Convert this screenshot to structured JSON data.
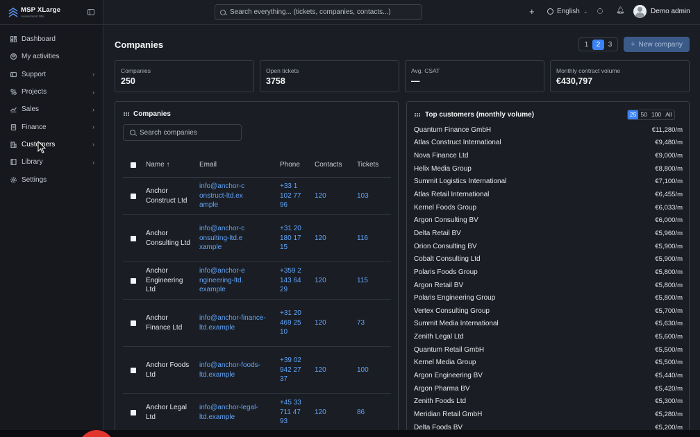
{
  "brand": {
    "name": "MSP XLarge",
    "subtitle": "Assessment Ntls"
  },
  "sidebar": {
    "items": [
      {
        "label": "Dashboard",
        "icon": "dashboard-icon",
        "chevron": false
      },
      {
        "label": "My activities",
        "icon": "user-circle-icon",
        "chevron": false
      },
      {
        "label": "Support",
        "icon": "ticket-icon",
        "chevron": true
      },
      {
        "label": "Projects",
        "icon": "projects-icon",
        "chevron": true
      },
      {
        "label": "Sales",
        "icon": "trend-icon",
        "chevron": true
      },
      {
        "label": "Finance",
        "icon": "document-icon",
        "chevron": true
      },
      {
        "label": "Customers",
        "icon": "building-icon",
        "chevron": true
      },
      {
        "label": "Library",
        "icon": "book-icon",
        "chevron": true
      },
      {
        "label": "Settings",
        "icon": "gear-icon",
        "chevron": false
      }
    ]
  },
  "topbar": {
    "search_placeholder": "Search everything... (tickets, companies, contacts...)",
    "language": "English",
    "user_name": "Demo admin"
  },
  "page": {
    "title": "Companies",
    "pages": [
      "1",
      "2",
      "3"
    ],
    "active_page": "2",
    "new_button": "New company"
  },
  "stats": [
    {
      "label": "Companies",
      "value": "250"
    },
    {
      "label": "Open tickets",
      "value": "3758"
    },
    {
      "label": "Avg. CSAT",
      "value": "—"
    },
    {
      "label": "Monthly contract volume",
      "value": "€430,797"
    }
  ],
  "companies_panel": {
    "title": "Companies",
    "search_placeholder": "Search companies",
    "columns": {
      "name": "Name ↑",
      "email": "Email",
      "phone": "Phone",
      "contacts": "Contacts",
      "tickets": "Tickets"
    },
    "rows": [
      {
        "name": "Anchor Construct Ltd",
        "email": "info@anchor-construct-ltd.example",
        "phone": "+33 1 102 77 96",
        "contacts": "120",
        "tickets": "103"
      },
      {
        "name": "Anchor Consulting Ltd",
        "email": "info@anchor-consulting-ltd.example",
        "phone": "+31 20 180 17 15",
        "contacts": "120",
        "tickets": "116"
      },
      {
        "name": "Anchor Engineering Ltd",
        "email": "info@anchor-engineering-ltd.example",
        "phone": "+359 2 143 64 29",
        "contacts": "120",
        "tickets": "115"
      },
      {
        "name": "Anchor Finance Ltd",
        "email": "info@anchor-finance-ltd.example",
        "phone": "+31 20 469 25 10",
        "contacts": "120",
        "tickets": "73"
      },
      {
        "name": "Anchor Foods Ltd",
        "email": "info@anchor-foods-ltd.example",
        "phone": "+39 02 942 27 37",
        "contacts": "120",
        "tickets": "100"
      },
      {
        "name": "Anchor Legal Ltd",
        "email": "info@anchor-legal-ltd.example",
        "phone": "+45 33 711 47 93",
        "contacts": "120",
        "tickets": "86"
      }
    ]
  },
  "top_customers": {
    "title": "Top customers (monthly volume)",
    "options": [
      "25",
      "50",
      "100",
      "All"
    ],
    "active_option": "25",
    "rows": [
      {
        "name": "Quantum Finance GmbH",
        "value": "€11,280/m"
      },
      {
        "name": "Atlas Construct International",
        "value": "€9,480/m"
      },
      {
        "name": "Nova Finance Ltd",
        "value": "€9,000/m"
      },
      {
        "name": "Helix Media Group",
        "value": "€8,800/m"
      },
      {
        "name": "Summit Logistics International",
        "value": "€7,100/m"
      },
      {
        "name": "Atlas Retail International",
        "value": "€6,455/m"
      },
      {
        "name": "Kernel Foods Group",
        "value": "€6,033/m"
      },
      {
        "name": "Argon Consulting BV",
        "value": "€6,000/m"
      },
      {
        "name": "Delta Retail BV",
        "value": "€5,960/m"
      },
      {
        "name": "Orion Consulting BV",
        "value": "€5,900/m"
      },
      {
        "name": "Cobalt Consulting Ltd",
        "value": "€5,900/m"
      },
      {
        "name": "Polaris Foods Group",
        "value": "€5,800/m"
      },
      {
        "name": "Argon Retail BV",
        "value": "€5,800/m"
      },
      {
        "name": "Polaris Engineering Group",
        "value": "€5,800/m"
      },
      {
        "name": "Vertex Consulting Group",
        "value": "€5,700/m"
      },
      {
        "name": "Summit Media International",
        "value": "€5,630/m"
      },
      {
        "name": "Zenith Legal Ltd",
        "value": "€5,600/m"
      },
      {
        "name": "Quantum Retail GmbH",
        "value": "€5,500/m"
      },
      {
        "name": "Kernel Media Group",
        "value": "€5,500/m"
      },
      {
        "name": "Argon Engineering BV",
        "value": "€5,440/m"
      },
      {
        "name": "Argon Pharma BV",
        "value": "€5,420/m"
      },
      {
        "name": "Zenith Foods Ltd",
        "value": "€5,300/m"
      },
      {
        "name": "Meridian Retail GmbH",
        "value": "€5,280/m"
      },
      {
        "name": "Delta Foods BV",
        "value": "€5,200/m"
      }
    ]
  },
  "colors": {
    "accent": "#3b82f6",
    "link": "#60a5fa",
    "background": "#1a1d23",
    "sidebar": "#16181d"
  }
}
